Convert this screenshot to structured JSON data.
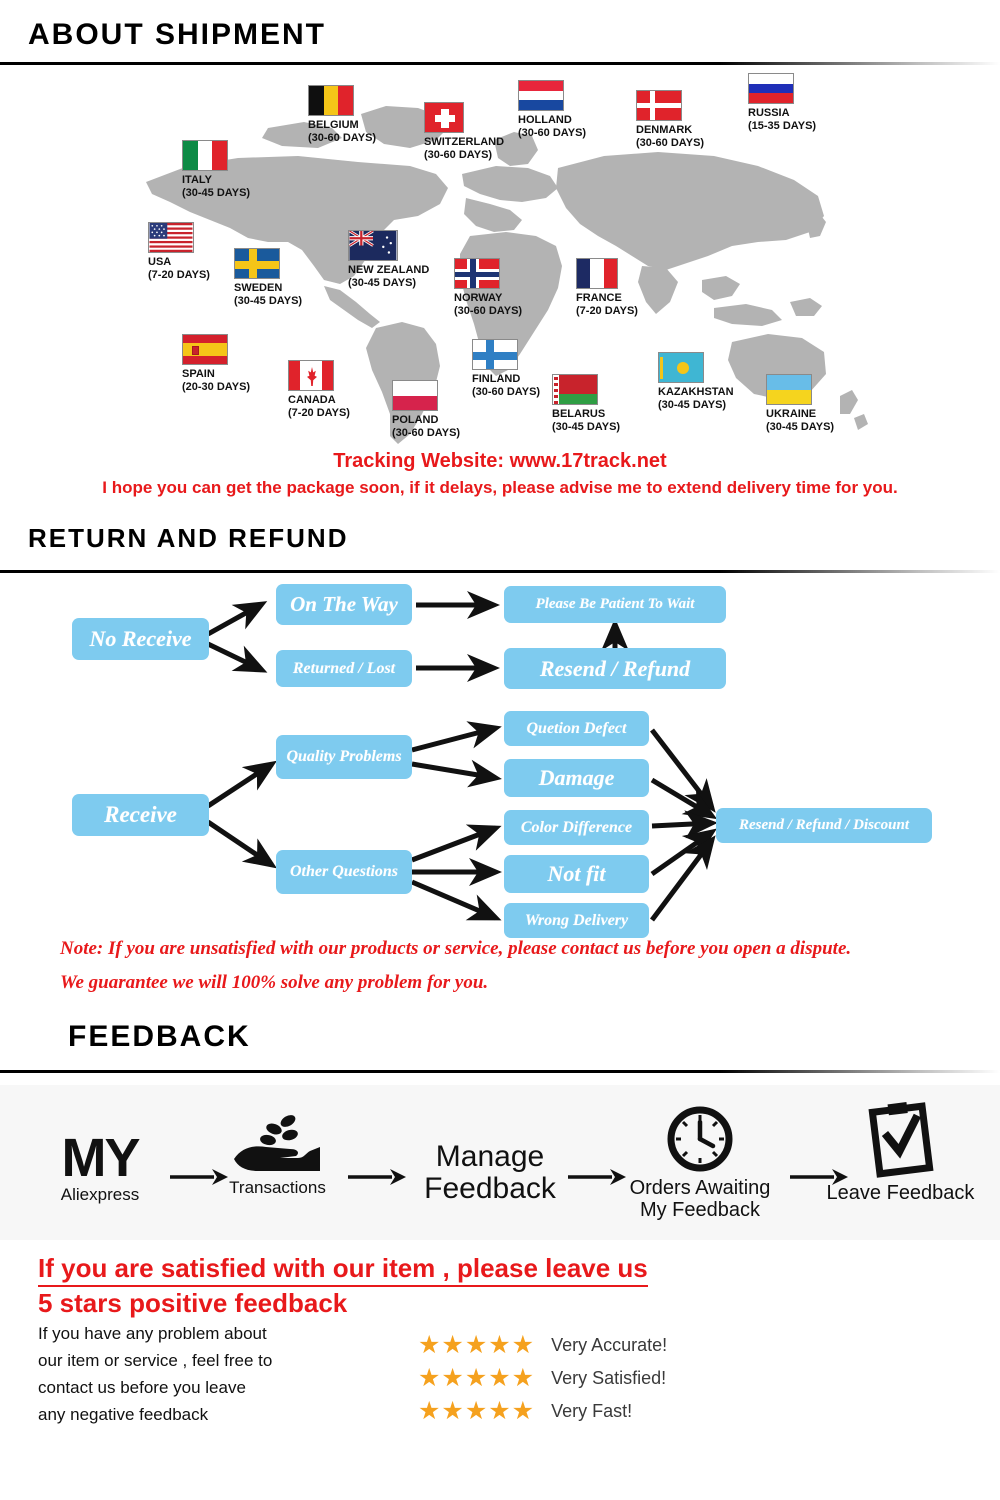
{
  "sections": {
    "shipment": {
      "title": "ABOUT  SHIPMENT"
    },
    "return": {
      "title": "RETURN  AND  REFUND"
    },
    "feedback": {
      "title": "FEEDBACK"
    }
  },
  "shipment": {
    "countries": [
      {
        "name": "ITALY",
        "days": "(30-45 DAYS)",
        "flag": "italy"
      },
      {
        "name": "BELGIUM",
        "days": "(30-60 DAYS)",
        "flag": "belgium"
      },
      {
        "name": "SWITZERLAND",
        "days": "(30-60 DAYS)",
        "flag": "switzerland"
      },
      {
        "name": "HOLLAND",
        "days": "(30-60 DAYS)",
        "flag": "holland"
      },
      {
        "name": "DENMARK",
        "days": "(30-60 DAYS)",
        "flag": "denmark"
      },
      {
        "name": "RUSSIA",
        "days": "(15-35 DAYS)",
        "flag": "russia"
      },
      {
        "name": "USA",
        "days": "(7-20 DAYS)",
        "flag": "usa"
      },
      {
        "name": "SWEDEN",
        "days": "(30-45 DAYS)",
        "flag": "sweden"
      },
      {
        "name": "NEW ZEALAND",
        "days": "(30-45 DAYS)",
        "flag": "newzealand"
      },
      {
        "name": "NORWAY",
        "days": "(30-60 DAYS)",
        "flag": "norway"
      },
      {
        "name": "FRANCE",
        "days": "(7-20 DAYS)",
        "flag": "france"
      },
      {
        "name": "SPAIN",
        "days": "(20-30 DAYS)",
        "flag": "spain"
      },
      {
        "name": "CANADA",
        "days": "(7-20 DAYS)",
        "flag": "canada"
      },
      {
        "name": "POLAND",
        "days": "(30-60 DAYS)",
        "flag": "poland"
      },
      {
        "name": "FINLAND",
        "days": "(30-60 DAYS)",
        "flag": "finland"
      },
      {
        "name": "BELARUS",
        "days": "(30-45 DAYS)",
        "flag": "belarus"
      },
      {
        "name": "KAZAKHSTAN",
        "days": "(30-45 DAYS)",
        "flag": "kazakhstan"
      },
      {
        "name": "UKRAINE",
        "days": "(30-45 DAYS)",
        "flag": "ukraine"
      }
    ],
    "tracking_line": "Tracking Website: www.17track.net",
    "hope_line": "I hope you can get the package soon, if it delays, please advise me to extend delivery time for you."
  },
  "flowchart": {
    "nodes": {
      "no_receive": "No Receive",
      "on_the_way": "On The Way",
      "returned_lost": "Returned / Lost",
      "be_patient": "Please Be Patient To Wait",
      "resend_refund": "Resend / Refund",
      "receive": "Receive",
      "quality_problems": "Quality Problems",
      "other_questions": "Other Questions",
      "quetion_defect": "Quetion Defect",
      "damage": "Damage",
      "color_difference": "Color Difference",
      "not_fit": "Not fit",
      "wrong_delivery": "Wrong Delivery",
      "resend_refund_discount": "Resend / Refund / Discount"
    },
    "note_line1": "Note: If you are unsatisfied with our products or service, please contact us before you open a dispute.",
    "note_line2": "We guarantee we will 100% solve any problem for you."
  },
  "feedback": {
    "steps": [
      {
        "label": "MY",
        "caption": "Aliexpress",
        "icon": "my-text-icon"
      },
      {
        "label": "",
        "caption": "Transactions",
        "icon": "hand-coins-icon"
      },
      {
        "label": "Manage\nFeedback",
        "caption": "",
        "icon": "manage-text-icon"
      },
      {
        "label": "",
        "caption": "Orders Awaiting\nMy Feedback",
        "icon": "clock-icon"
      },
      {
        "label": "",
        "caption": "Leave Feedback",
        "icon": "clipboard-check-icon"
      }
    ],
    "headline_line1": "If you are satisfied with our item , please leave us",
    "headline_line2": "5 stars positive feedback",
    "body": "If you have any problem about\nour item or service , feel free to\ncontact us before you  leave\nany negative feedback",
    "ratings": [
      {
        "stars": "★★★★★",
        "text": "Very Accurate!"
      },
      {
        "stars": "★★★★★",
        "text": "Very Satisfied!"
      },
      {
        "stars": "★★★★★",
        "text": "Very Fast!"
      }
    ]
  },
  "colors": {
    "accent_blue": "#7ecbef",
    "accent_red": "#e8191b",
    "star_orange": "#f5a11e",
    "map_gray": "#b3b3b3"
  }
}
